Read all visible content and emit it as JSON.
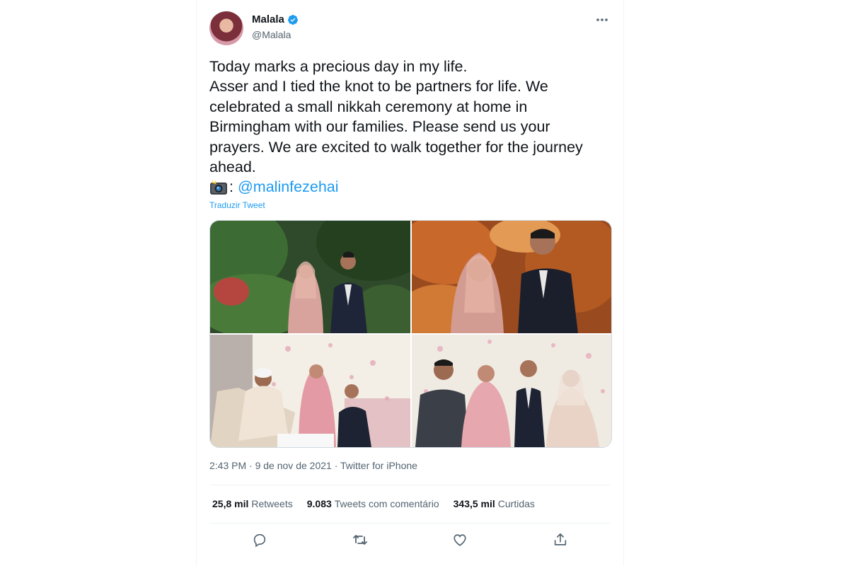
{
  "author": {
    "name": "Malala",
    "handle": "@Malala",
    "verified_color": "#1d9bf0"
  },
  "tweet": {
    "lines": [
      "Today marks a precious day in my life.",
      "Asser and I tied the knot to be partners for life. We celebrated a small nikkah ceremony at home in Birmingham with our families. Please send us your prayers. We are excited to walk together for the journey ahead."
    ],
    "camera_icon": "camera-flash-icon",
    "colon": ":",
    "mention": "@malinfezehai",
    "translate_label": "Traduzir Tweet"
  },
  "meta": {
    "time": "2:43 PM",
    "sep1": " · ",
    "date": "9 de nov de 2021",
    "sep2": " · ",
    "source": "Twitter for iPhone"
  },
  "stats": {
    "retweets_count": "25,8 mil",
    "retweets_label": "Retweets",
    "quotes_count": "9.083",
    "quotes_label": "Tweets com comentário",
    "likes_count": "343,5 mil",
    "likes_label": "Curtidas"
  },
  "actions": [
    "reply-icon",
    "retweet-icon",
    "like-icon",
    "share-icon"
  ],
  "colors": {
    "accent": "#1d9bf0",
    "text": "#0f1419",
    "secondary": "#536471"
  }
}
